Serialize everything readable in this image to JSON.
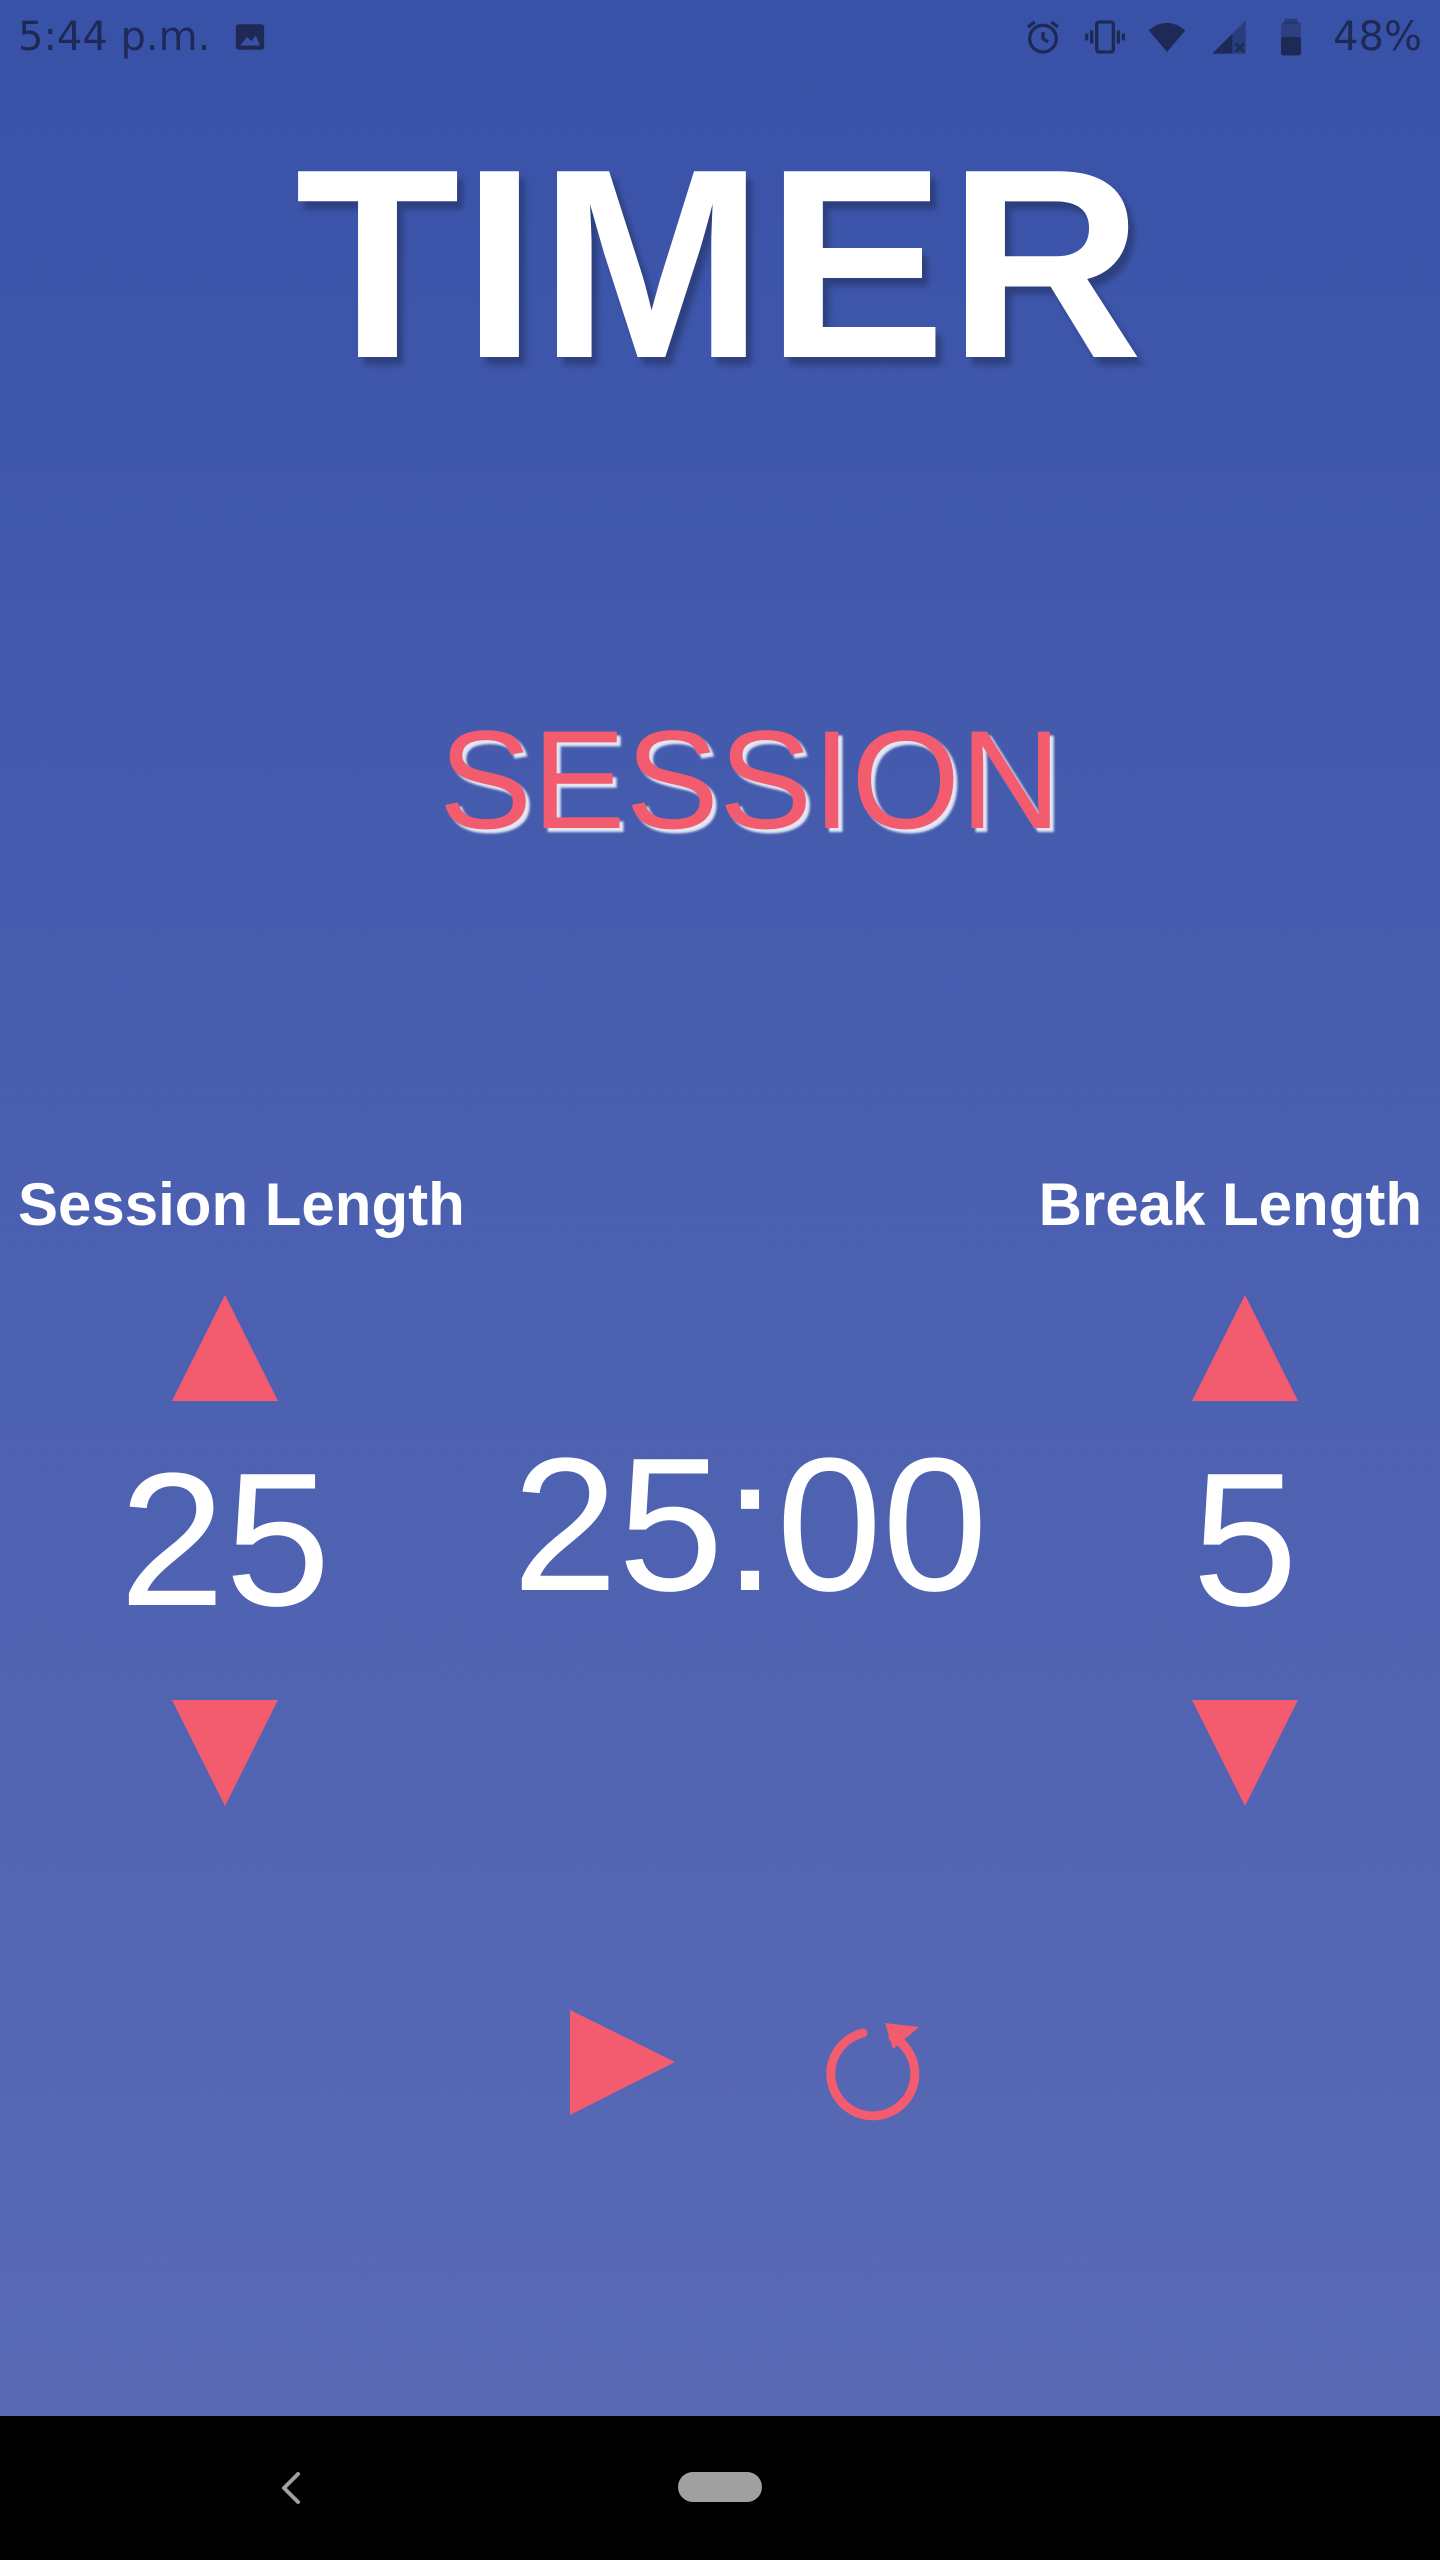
{
  "status_bar": {
    "time": "5:44 p.m.",
    "battery": "48%",
    "icons": [
      "gallery-icon",
      "alarm-icon",
      "vibrate-icon",
      "wifi-icon",
      "signal-icon",
      "battery-icon"
    ]
  },
  "app": {
    "title": "TIMER",
    "mode": "SESSION"
  },
  "session": {
    "label": "Session Length",
    "value": "25"
  },
  "break": {
    "label": "Break Length",
    "value": "5"
  },
  "timer": {
    "display": "25:00"
  },
  "controls": {
    "play_icon": "play-icon",
    "reset_icon": "reset-icon"
  },
  "colors": {
    "accent": "#f35c6f",
    "background_top": "#3852a8",
    "background_bottom": "#5b6bb6",
    "text": "#ffffff"
  },
  "nav_bar": {
    "icons": [
      "back-icon",
      "home-pill"
    ]
  }
}
